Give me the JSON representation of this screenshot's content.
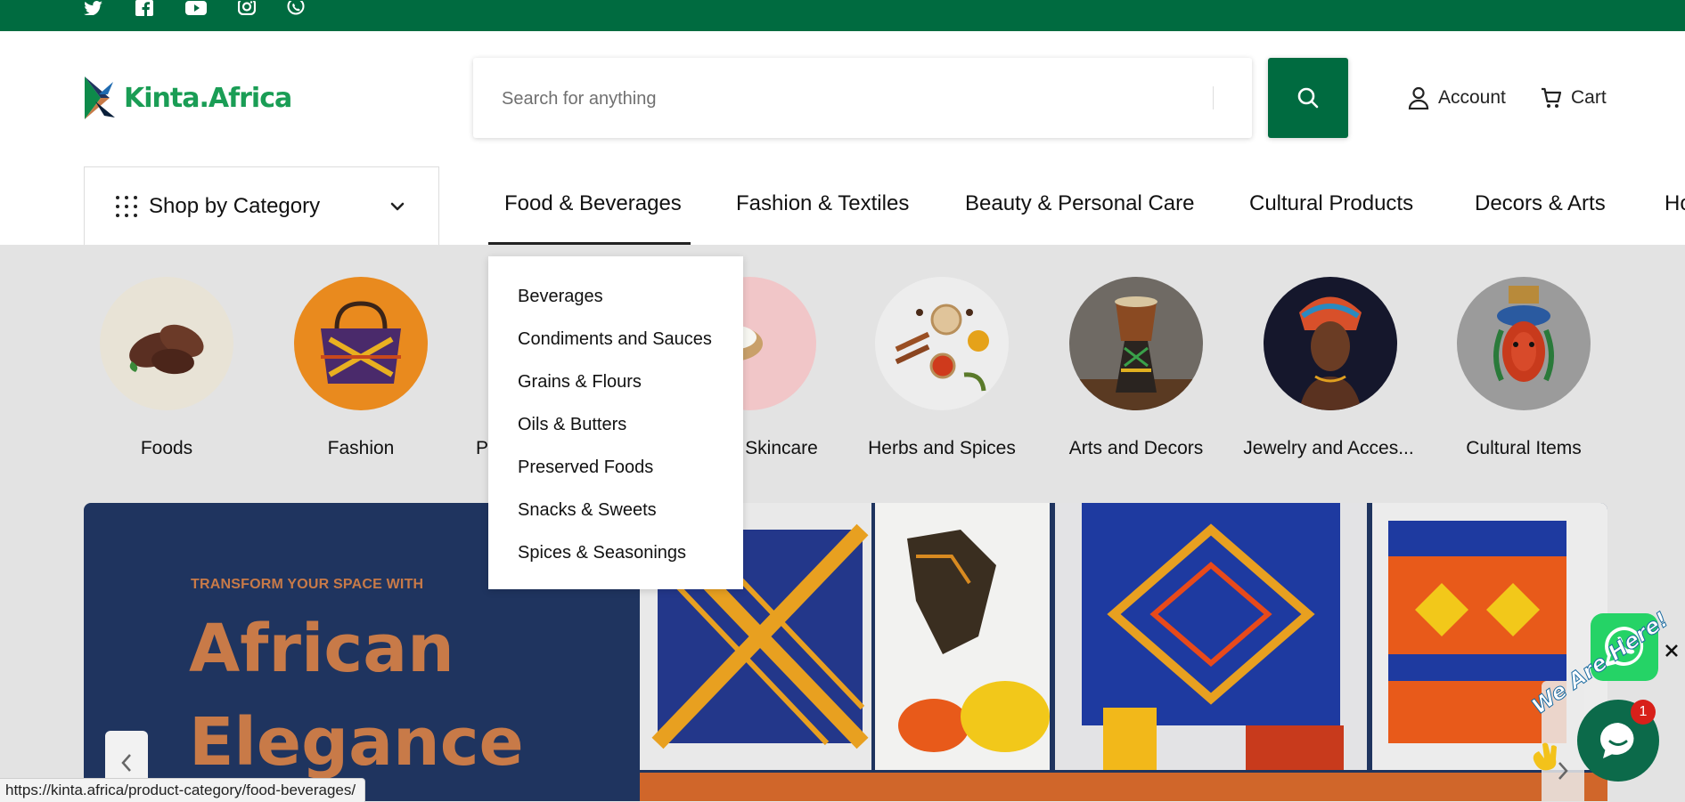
{
  "social": {
    "icons": [
      "twitter-icon",
      "facebook-icon",
      "youtube-icon",
      "instagram-icon",
      "whatsapp-icon"
    ]
  },
  "brand": {
    "name": "Kinta.Africa",
    "color": "#1a9d55",
    "topbar_color": "#006b40"
  },
  "search": {
    "placeholder": "Search for anything"
  },
  "header": {
    "account_label": "Account",
    "cart_label": "Cart"
  },
  "category_menu": {
    "label": "Shop by Category"
  },
  "nav": {
    "items": [
      "Food & Beverages",
      "Fashion & Textiles",
      "Beauty & Personal Care",
      "Cultural Products",
      "Decors & Arts",
      "Ho"
    ],
    "active": "Food & Beverages"
  },
  "dropdown": {
    "items": [
      "Beverages",
      "Condiments and Sauces",
      "Grains & Flours",
      "Oils & Butters",
      "Preserved Foods",
      "Snacks & Sweets",
      "Spices & Seasonings"
    ]
  },
  "categories": [
    {
      "label": "Foods",
      "icon": "cocoa-pods"
    },
    {
      "label": "Fashion",
      "icon": "woven-bag"
    },
    {
      "label": "P",
      "icon": "hidden"
    },
    {
      "label": "Skincare",
      "icon": "shea-butter"
    },
    {
      "label": "Herbs and Spices",
      "icon": "spices"
    },
    {
      "label": "Arts and Decors",
      "icon": "djembe-drum"
    },
    {
      "label": "Jewelry and Acces...",
      "icon": "woman-headwrap"
    },
    {
      "label": "Cultural Items",
      "icon": "mask-figure"
    }
  ],
  "banner": {
    "subtitle": "TRANSFORM YOUR SPACE WITH",
    "title_line1": "African",
    "title_line2": "Elegance",
    "bg_color": "#1f345f",
    "accent_color": "#c87a48"
  },
  "chat": {
    "tagline": "We Are Here!",
    "badge_count": "1"
  },
  "status_url": "https://kinta.africa/product-category/food-beverages/"
}
